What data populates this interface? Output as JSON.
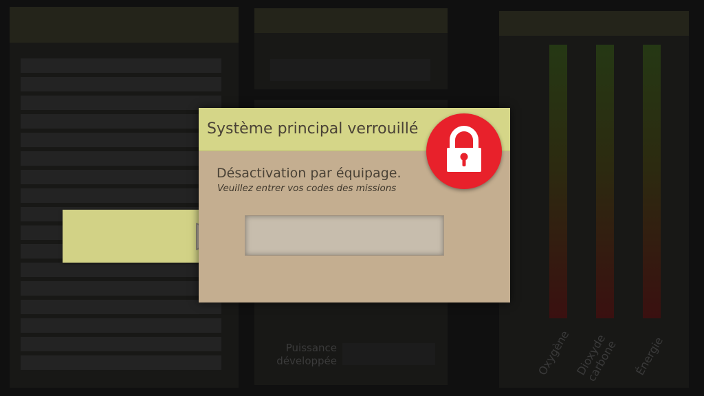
{
  "dialog": {
    "title": "Système principal verrouillé",
    "subtitle": "Désactivation par équipage.",
    "hint": "Veuillez entrer vos codes des missions",
    "code_value": "",
    "lock_icon": "padlock-icon"
  },
  "submit": {
    "icon": "play-arrow-icon"
  },
  "background": {
    "power_label": "Puissance développée",
    "gauges": [
      {
        "label": "Oxygène"
      },
      {
        "label": "Dioxyde carbone"
      },
      {
        "label": "Énergie"
      }
    ]
  },
  "colors": {
    "dialog_body": "#c4ae90",
    "dialog_header": "#d5d688",
    "lock": "#e8212b",
    "arrow_panel": "#d2d286"
  }
}
